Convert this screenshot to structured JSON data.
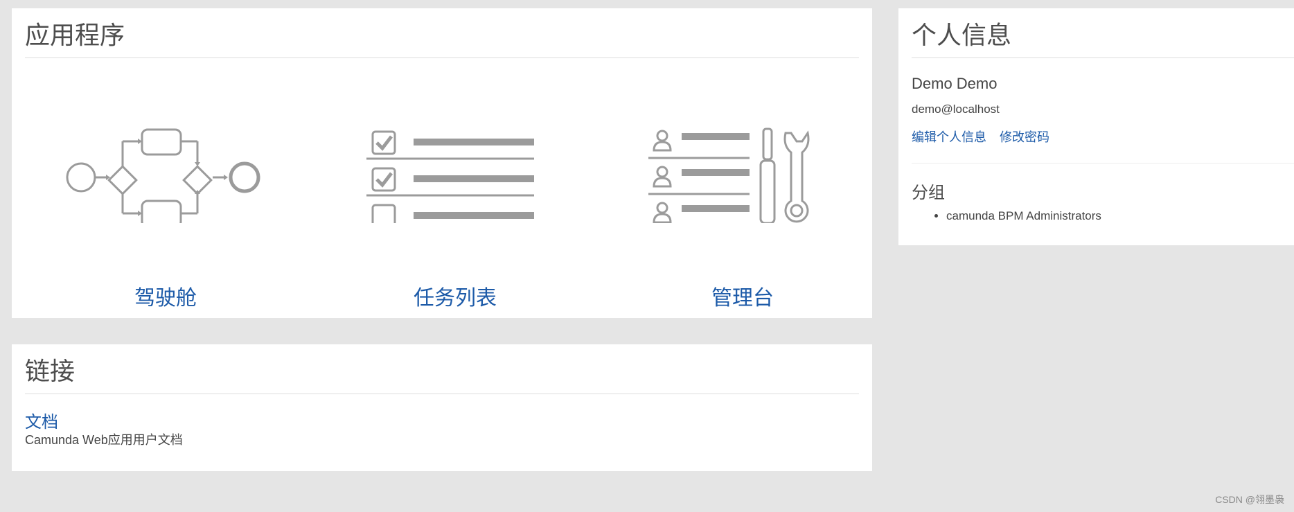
{
  "apps_panel": {
    "title": "应用程序",
    "apps": [
      {
        "label": "驾驶舱",
        "icon": "bpmn-process-icon"
      },
      {
        "label": "任务列表",
        "icon": "checklist-icon"
      },
      {
        "label": "管理台",
        "icon": "admin-tools-icon"
      }
    ]
  },
  "links_panel": {
    "title": "链接",
    "items": [
      {
        "label": "文档",
        "description": "Camunda Web应用用户文档"
      }
    ]
  },
  "profile_panel": {
    "title": "个人信息",
    "name": "Demo Demo",
    "email": "demo@localhost",
    "edit_profile": "编辑个人信息",
    "change_password": "修改密码",
    "groups_title": "分组",
    "groups": [
      "camunda BPM Administrators"
    ]
  },
  "watermark": "CSDN @翎墨袅",
  "colors": {
    "link": "#1c5aa8",
    "icon_gray": "#9b9b9b",
    "background": "#e5e5e5"
  }
}
